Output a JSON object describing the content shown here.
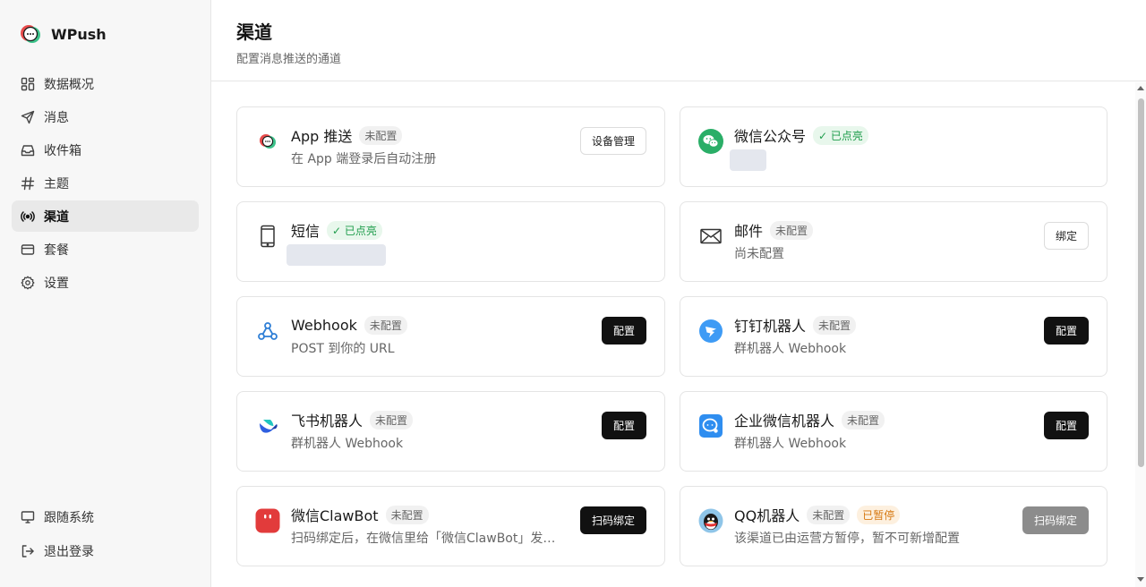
{
  "brand": {
    "name": "WPush"
  },
  "sidebar": {
    "items": [
      {
        "label": "数据概况",
        "icon": "dashboard-icon"
      },
      {
        "label": "消息",
        "icon": "send-icon"
      },
      {
        "label": "收件箱",
        "icon": "inbox-icon"
      },
      {
        "label": "主题",
        "icon": "hash-icon"
      },
      {
        "label": "渠道",
        "icon": "broadcast-icon",
        "active": true
      },
      {
        "label": "套餐",
        "icon": "card-icon"
      },
      {
        "label": "设置",
        "icon": "gear-icon"
      }
    ],
    "bottom": [
      {
        "label": "跟随系统",
        "icon": "monitor-icon"
      },
      {
        "label": "退出登录",
        "icon": "logout-icon"
      }
    ]
  },
  "header": {
    "title": "渠道",
    "subtitle": "配置消息推送的通道"
  },
  "channels": [
    {
      "title": "App 推送",
      "status": "未配置",
      "desc": "在 App 端登录后自动注册",
      "button": "设备管理",
      "icon": "app-push-icon"
    },
    {
      "title": "微信公众号",
      "status": "已点亮",
      "desc": "",
      "button": "",
      "icon": "wechat-icon"
    },
    {
      "title": "短信",
      "status": "已点亮",
      "desc": "",
      "button": "",
      "icon": "phone-icon"
    },
    {
      "title": "邮件",
      "status": "未配置",
      "desc": "尚未配置",
      "button": "绑定",
      "icon": "mail-icon"
    },
    {
      "title": "Webhook",
      "status": "未配置",
      "desc": "POST 到你的 URL",
      "button": "配置",
      "icon": "webhook-icon"
    },
    {
      "title": "钉钉机器人",
      "status": "未配置",
      "desc": "群机器人 Webhook",
      "button": "配置",
      "icon": "dingtalk-icon"
    },
    {
      "title": "飞书机器人",
      "status": "未配置",
      "desc": "群机器人 Webhook",
      "button": "配置",
      "icon": "feishu-icon"
    },
    {
      "title": "企业微信机器人",
      "status": "未配置",
      "desc": "群机器人 Webhook",
      "button": "配置",
      "icon": "wecom-icon"
    },
    {
      "title": "微信ClawBot",
      "status": "未配置",
      "desc": "扫码绑定后，在微信里给「微信ClawBot」发送任意消息即可完成绑定",
      "button": "扫码绑定",
      "icon": "clawbot-icon"
    },
    {
      "title": "QQ机器人",
      "status": "未配置",
      "status2": "已暂停",
      "desc": "该渠道已由运营方暂停，暂不可新增配置",
      "button": "扫码绑定",
      "icon": "qq-icon"
    }
  ],
  "colors": {
    "accent": "#111111",
    "on": "#1f9d4c",
    "paused": "#d77a14",
    "wechat": "#2aae67"
  }
}
